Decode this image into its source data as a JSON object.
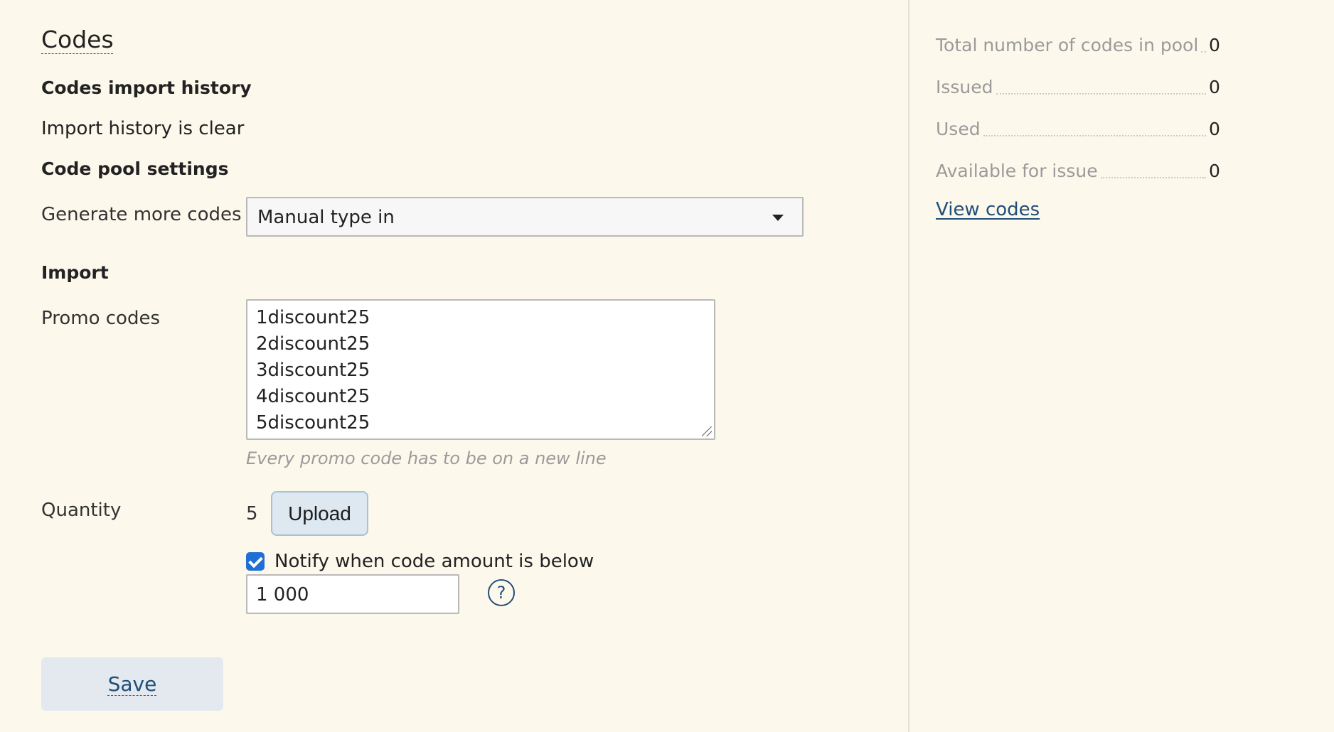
{
  "main": {
    "title": "Codes",
    "import_history": {
      "heading": "Codes import history",
      "status": "Import history is clear"
    },
    "pool_settings": {
      "heading": "Code pool settings",
      "generate_label": "Generate more codes",
      "generate_selected": "Manual type in"
    },
    "import": {
      "heading": "Import",
      "promo_label": "Promo codes",
      "promo_codes": [
        "1discount25",
        "2discount25",
        "3discount25",
        "4discount25",
        "5discount25"
      ],
      "promo_hint": "Every promo code has to be on a new line",
      "quantity_label": "Quantity",
      "quantity_value": "5",
      "upload_label": "Upload"
    },
    "notify": {
      "checked": true,
      "label": "Notify when code amount is below",
      "threshold": "1 000",
      "help_glyph": "?"
    },
    "save_label": "Save"
  },
  "sidebar": {
    "stats": [
      {
        "label": "Total number of codes in pool",
        "value": "0"
      },
      {
        "label": "Issued",
        "value": "0"
      },
      {
        "label": "Used",
        "value": "0"
      },
      {
        "label": "Available for issue",
        "value": "0"
      }
    ],
    "view_codes_label": "View codes"
  },
  "colors": {
    "background": "#fdf8ec",
    "link": "#1f4e79",
    "checkbox": "#1f6fd6",
    "button_bg": "#dde8f1"
  },
  "icons": {
    "dropdown": "chevron-down-icon",
    "help": "question-circle-icon",
    "checkbox": "checkmark-icon"
  }
}
